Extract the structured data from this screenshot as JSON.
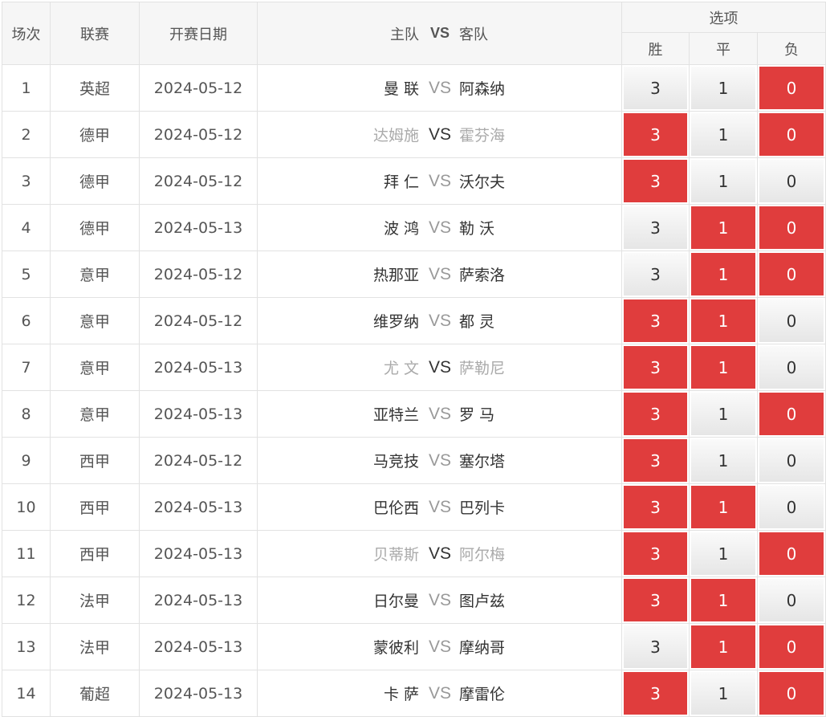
{
  "header": {
    "col_index": "场次",
    "col_league": "联赛",
    "col_date": "开赛日期",
    "col_home": "主队",
    "col_vs": "VS",
    "col_away": "客队",
    "col_options": "选项",
    "opt_win": "胜",
    "opt_draw": "平",
    "opt_lose": "负"
  },
  "colors": {
    "selected": "#e03d3d",
    "dim_team": "#aaaaaa"
  },
  "rows": [
    {
      "no": "1",
      "league": "英超",
      "date": "2024-05-12",
      "home": "曼 联",
      "vs": "VS",
      "away": "阿森纳",
      "w": "3",
      "d": "1",
      "l": "0",
      "sel": [
        false,
        false,
        true
      ],
      "dim": false
    },
    {
      "no": "2",
      "league": "德甲",
      "date": "2024-05-12",
      "home": "达姆施",
      "vs": "VS",
      "away": "霍芬海",
      "w": "3",
      "d": "1",
      "l": "0",
      "sel": [
        true,
        false,
        true
      ],
      "dim": true
    },
    {
      "no": "3",
      "league": "德甲",
      "date": "2024-05-12",
      "home": "拜 仁",
      "vs": "VS",
      "away": "沃尔夫",
      "w": "3",
      "d": "1",
      "l": "0",
      "sel": [
        true,
        false,
        false
      ],
      "dim": false
    },
    {
      "no": "4",
      "league": "德甲",
      "date": "2024-05-13",
      "home": "波 鸿",
      "vs": "VS",
      "away": "勒 沃",
      "w": "3",
      "d": "1",
      "l": "0",
      "sel": [
        false,
        true,
        true
      ],
      "dim": false
    },
    {
      "no": "5",
      "league": "意甲",
      "date": "2024-05-12",
      "home": "热那亚",
      "vs": "VS",
      "away": "萨索洛",
      "w": "3",
      "d": "1",
      "l": "0",
      "sel": [
        false,
        true,
        true
      ],
      "dim": false
    },
    {
      "no": "6",
      "league": "意甲",
      "date": "2024-05-12",
      "home": "维罗纳",
      "vs": "VS",
      "away": "都 灵",
      "w": "3",
      "d": "1",
      "l": "0",
      "sel": [
        true,
        true,
        false
      ],
      "dim": false
    },
    {
      "no": "7",
      "league": "意甲",
      "date": "2024-05-13",
      "home": "尤 文",
      "vs": "VS",
      "away": "萨勒尼",
      "w": "3",
      "d": "1",
      "l": "0",
      "sel": [
        true,
        true,
        false
      ],
      "dim": true
    },
    {
      "no": "8",
      "league": "意甲",
      "date": "2024-05-13",
      "home": "亚特兰",
      "vs": "VS",
      "away": "罗 马",
      "w": "3",
      "d": "1",
      "l": "0",
      "sel": [
        true,
        false,
        true
      ],
      "dim": false
    },
    {
      "no": "9",
      "league": "西甲",
      "date": "2024-05-12",
      "home": "马竞技",
      "vs": "VS",
      "away": "塞尔塔",
      "w": "3",
      "d": "1",
      "l": "0",
      "sel": [
        true,
        false,
        false
      ],
      "dim": false
    },
    {
      "no": "10",
      "league": "西甲",
      "date": "2024-05-13",
      "home": "巴伦西",
      "vs": "VS",
      "away": "巴列卡",
      "w": "3",
      "d": "1",
      "l": "0",
      "sel": [
        true,
        true,
        false
      ],
      "dim": false
    },
    {
      "no": "11",
      "league": "西甲",
      "date": "2024-05-13",
      "home": "贝蒂斯",
      "vs": "VS",
      "away": "阿尔梅",
      "w": "3",
      "d": "1",
      "l": "0",
      "sel": [
        true,
        false,
        true
      ],
      "dim": true
    },
    {
      "no": "12",
      "league": "法甲",
      "date": "2024-05-13",
      "home": "日尔曼",
      "vs": "VS",
      "away": "图卢兹",
      "w": "3",
      "d": "1",
      "l": "0",
      "sel": [
        true,
        true,
        false
      ],
      "dim": false
    },
    {
      "no": "13",
      "league": "法甲",
      "date": "2024-05-13",
      "home": "蒙彼利",
      "vs": "VS",
      "away": "摩纳哥",
      "w": "3",
      "d": "1",
      "l": "0",
      "sel": [
        false,
        true,
        true
      ],
      "dim": false
    },
    {
      "no": "14",
      "league": "葡超",
      "date": "2024-05-13",
      "home": "卡 萨",
      "vs": "VS",
      "away": "摩雷伦",
      "w": "3",
      "d": "1",
      "l": "0",
      "sel": [
        true,
        false,
        true
      ],
      "dim": false
    }
  ]
}
